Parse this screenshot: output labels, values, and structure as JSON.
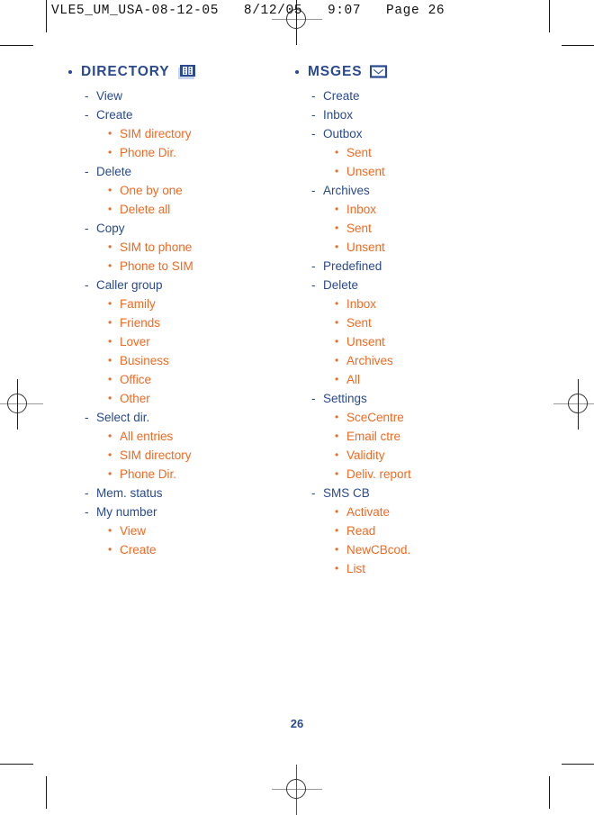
{
  "print_header": {
    "text": "VLE5_UM_USA-08-12-05   8/12/05   9:07   Page 26"
  },
  "colors": {
    "heading_blue": "#2a4a8f",
    "item_orange": "#ef6a23",
    "crop_mark": "#1a1a1a"
  },
  "page_number": "26",
  "columns": [
    {
      "id": "directory",
      "heading": "DIRECTORY",
      "icon": "contact-card-icon",
      "items": [
        {
          "level": 1,
          "text": "View"
        },
        {
          "level": 1,
          "text": "Create"
        },
        {
          "level": 2,
          "text": "SIM directory"
        },
        {
          "level": 2,
          "text": "Phone Dir."
        },
        {
          "level": 1,
          "text": "Delete"
        },
        {
          "level": 2,
          "text": "One by one"
        },
        {
          "level": 2,
          "text": "Delete all"
        },
        {
          "level": 1,
          "text": "Copy"
        },
        {
          "level": 2,
          "text": "SIM to phone"
        },
        {
          "level": 2,
          "text": "Phone to SIM"
        },
        {
          "level": 1,
          "text": "Caller group"
        },
        {
          "level": 2,
          "text": "Family"
        },
        {
          "level": 2,
          "text": "Friends"
        },
        {
          "level": 2,
          "text": "Lover"
        },
        {
          "level": 2,
          "text": "Business"
        },
        {
          "level": 2,
          "text": "Office"
        },
        {
          "level": 2,
          "text": "Other"
        },
        {
          "level": 1,
          "text": "Select dir."
        },
        {
          "level": 2,
          "text": "All entries"
        },
        {
          "level": 2,
          "text": "SIM directory"
        },
        {
          "level": 2,
          "text": "Phone Dir."
        },
        {
          "level": 1,
          "text": "Mem. status"
        },
        {
          "level": 1,
          "text": "My number"
        },
        {
          "level": 2,
          "text": "View"
        },
        {
          "level": 2,
          "text": "Create"
        }
      ]
    },
    {
      "id": "msges",
      "heading": "MSGES",
      "icon": "envelope-icon",
      "items": [
        {
          "level": 1,
          "text": "Create"
        },
        {
          "level": 1,
          "text": "Inbox"
        },
        {
          "level": 1,
          "text": "Outbox"
        },
        {
          "level": 2,
          "text": "Sent"
        },
        {
          "level": 2,
          "text": "Unsent"
        },
        {
          "level": 1,
          "text": "Archives"
        },
        {
          "level": 2,
          "text": "Inbox"
        },
        {
          "level": 2,
          "text": "Sent"
        },
        {
          "level": 2,
          "text": "Unsent"
        },
        {
          "level": 1,
          "text": "Predefined"
        },
        {
          "level": 1,
          "text": "Delete"
        },
        {
          "level": 2,
          "text": "Inbox"
        },
        {
          "level": 2,
          "text": "Sent"
        },
        {
          "level": 2,
          "text": "Unsent"
        },
        {
          "level": 2,
          "text": "Archives"
        },
        {
          "level": 2,
          "text": "All"
        },
        {
          "level": 1,
          "text": "Settings"
        },
        {
          "level": 2,
          "text": "SceCentre"
        },
        {
          "level": 2,
          "text": "Email ctre"
        },
        {
          "level": 2,
          "text": "Validity"
        },
        {
          "level": 2,
          "text": "Deliv. report"
        },
        {
          "level": 1,
          "text": "SMS CB"
        },
        {
          "level": 2,
          "text": "Activate"
        },
        {
          "level": 2,
          "text": "Read"
        },
        {
          "level": 2,
          "text": "NewCBcod."
        },
        {
          "level": 2,
          "text": "List"
        }
      ]
    }
  ],
  "glyphs": {
    "dash": "-",
    "bullet": "•"
  }
}
